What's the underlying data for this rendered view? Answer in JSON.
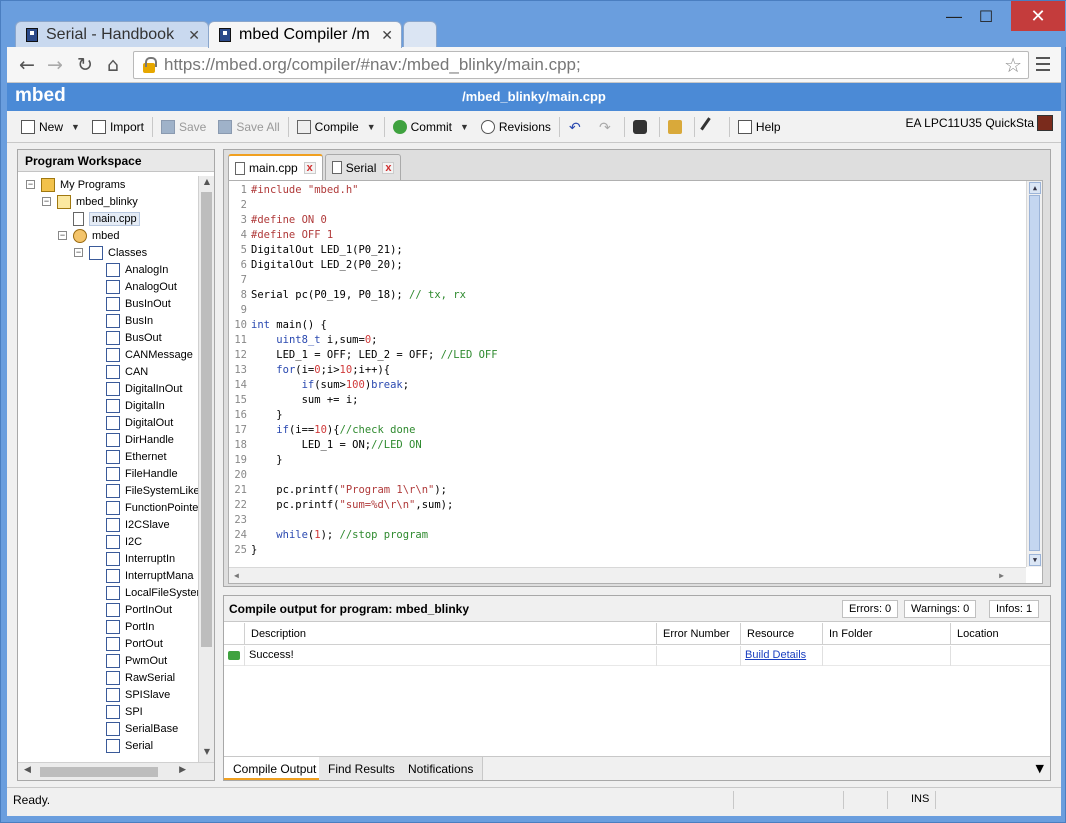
{
  "browser": {
    "tabs": [
      {
        "title": "Serial - Handbook"
      },
      {
        "title": "mbed Compiler /m"
      }
    ],
    "url": "https://mbed.org/compiler/#nav:/mbed_blinky/main.cpp;"
  },
  "app": {
    "logo": "mbed",
    "file_path": "/mbed_blinky/main.cpp",
    "toolbar": {
      "new": "New",
      "import": "Import",
      "save": "Save",
      "save_all": "Save All",
      "compile": "Compile",
      "commit": "Commit",
      "revisions": "Revisions",
      "help": "Help",
      "platform": "EA LPC11U35 QuickSta"
    }
  },
  "workspace": {
    "title": "Program Workspace",
    "root": "My Programs",
    "project": "mbed_blinky",
    "file": "main.cpp",
    "library": "mbed",
    "classes_label": "Classes",
    "classes": [
      "AnalogIn",
      "AnalogOut",
      "BusInOut",
      "BusIn",
      "BusOut",
      "CANMessage",
      "CAN",
      "DigitalInOut",
      "DigitalIn",
      "DigitalOut",
      "DirHandle",
      "Ethernet",
      "FileHandle",
      "FileSystemLike",
      "FunctionPointe",
      "I2CSlave",
      "I2C",
      "InterruptIn",
      "InterruptMana",
      "LocalFileSyster",
      "PortInOut",
      "PortIn",
      "PortOut",
      "PwmOut",
      "RawSerial",
      "SPISlave",
      "SPI",
      "SerialBase",
      "Serial"
    ]
  },
  "editor": {
    "tabs": [
      {
        "label": "main.cpp"
      },
      {
        "label": "Serial"
      }
    ],
    "lines": [
      [
        {
          "t": "#include \"mbed.h\"",
          "c": "pp"
        }
      ],
      [],
      [
        {
          "t": "#define ON 0",
          "c": "pp"
        }
      ],
      [
        {
          "t": "#define OFF 1",
          "c": "pp"
        }
      ],
      [
        {
          "t": "DigitalOut LED_1(P0_21);",
          "c": ""
        }
      ],
      [
        {
          "t": "DigitalOut LED_2(P0_20);",
          "c": ""
        }
      ],
      [],
      [
        {
          "t": "Serial pc(P0_19, P0_18); ",
          "c": ""
        },
        {
          "t": "// tx, rx",
          "c": "cm"
        }
      ],
      [],
      [
        {
          "t": "int",
          "c": "kw"
        },
        {
          "t": " main() {",
          "c": ""
        }
      ],
      [
        {
          "t": "    ",
          "c": ""
        },
        {
          "t": "uint8_t",
          "c": "kw"
        },
        {
          "t": " i,sum=",
          "c": ""
        },
        {
          "t": "0",
          "c": "num"
        },
        {
          "t": ";",
          "c": ""
        }
      ],
      [
        {
          "t": "    LED_1 = OFF; LED_2 = OFF; ",
          "c": ""
        },
        {
          "t": "//LED OFF",
          "c": "cm"
        }
      ],
      [
        {
          "t": "    ",
          "c": ""
        },
        {
          "t": "for",
          "c": "kw"
        },
        {
          "t": "(i=",
          "c": ""
        },
        {
          "t": "0",
          "c": "num"
        },
        {
          "t": ";i>",
          "c": ""
        },
        {
          "t": "10",
          "c": "num"
        },
        {
          "t": ";i++){",
          "c": ""
        }
      ],
      [
        {
          "t": "        ",
          "c": ""
        },
        {
          "t": "if",
          "c": "kw"
        },
        {
          "t": "(sum>",
          "c": ""
        },
        {
          "t": "100",
          "c": "num"
        },
        {
          "t": ")",
          "c": ""
        },
        {
          "t": "break",
          "c": "kw"
        },
        {
          "t": ";",
          "c": ""
        }
      ],
      [
        {
          "t": "        sum += i;",
          "c": ""
        }
      ],
      [
        {
          "t": "    }",
          "c": ""
        }
      ],
      [
        {
          "t": "    ",
          "c": ""
        },
        {
          "t": "if",
          "c": "kw"
        },
        {
          "t": "(i==",
          "c": ""
        },
        {
          "t": "10",
          "c": "num"
        },
        {
          "t": "){",
          "c": ""
        },
        {
          "t": "//check done",
          "c": "cm"
        }
      ],
      [
        {
          "t": "        LED_1 = ON;",
          "c": ""
        },
        {
          "t": "//LED ON",
          "c": "cm"
        }
      ],
      [
        {
          "t": "    }",
          "c": ""
        }
      ],
      [],
      [
        {
          "t": "    pc.printf(",
          "c": ""
        },
        {
          "t": "\"Program 1\\r\\n\"",
          "c": "str"
        },
        {
          "t": ");",
          "c": ""
        }
      ],
      [
        {
          "t": "    pc.printf(",
          "c": ""
        },
        {
          "t": "\"sum=%d\\r\\n\"",
          "c": "str"
        },
        {
          "t": ",sum);",
          "c": ""
        }
      ],
      [],
      [
        {
          "t": "    ",
          "c": ""
        },
        {
          "t": "while",
          "c": "kw"
        },
        {
          "t": "(",
          "c": ""
        },
        {
          "t": "1",
          "c": "num"
        },
        {
          "t": "); ",
          "c": ""
        },
        {
          "t": "//stop program",
          "c": "cm"
        }
      ],
      [
        {
          "t": "}",
          "c": ""
        }
      ]
    ]
  },
  "output": {
    "title": "Compile output for program: mbed_blinky",
    "errors": "Errors: 0",
    "warnings": "Warnings: 0",
    "infos": "Infos: 1",
    "columns": [
      "Description",
      "Error Number",
      "Resource",
      "In Folder",
      "Location"
    ],
    "rows": [
      {
        "description": "Success!",
        "error_number": "",
        "resource": "Build Details",
        "folder": "",
        "location": ""
      }
    ],
    "tabs": [
      "Compile Output",
      "Find Results",
      "Notifications"
    ]
  },
  "status": {
    "text": "Ready.",
    "mode": "INS"
  },
  "colors": {
    "header_blue": "#4b8ad6",
    "success_green": "#3fa23f",
    "active_tab_accent": "#f0a020"
  }
}
